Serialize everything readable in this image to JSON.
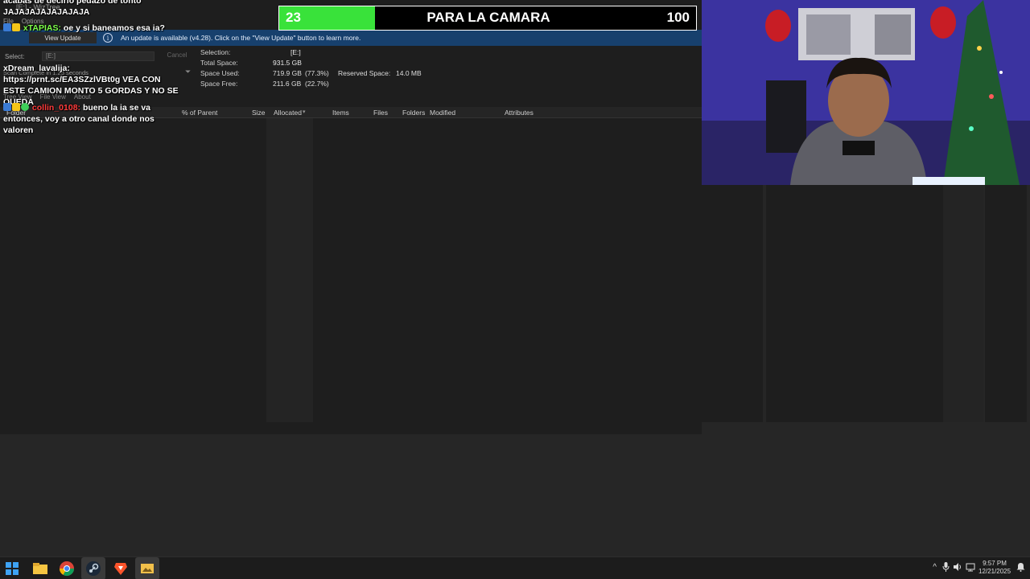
{
  "app": {
    "title": "[E:] - WizTree",
    "menu": [
      "File",
      "Options"
    ],
    "update_button": "View Update",
    "update_message": "An update is available (v4.28). Click on the \"View Update\" button to learn more.",
    "select_label": "Select:",
    "select_value": "[E:]",
    "cancel_label": "Cancel",
    "scan_status": "Scan Complete in 1.23 seconds",
    "stats": {
      "selection_label": "Selection:",
      "selection_value": "[E:]",
      "total_label": "Total Space:",
      "total_value": "931.5 GB",
      "used_label": "Space Used:",
      "used_value": "719.9 GB",
      "used_pct": "(77.3%)",
      "reserved_label": "Reserved Space:",
      "reserved_value": "14.0 MB",
      "free_label": "Space Free:",
      "free_value": "211.6 GB",
      "free_pct": "(22.7%)"
    },
    "tabs": [
      "Tree View",
      "File View",
      "About"
    ],
    "columns": {
      "folder": "Folder",
      "percent": "% of Parent",
      "size": "Size",
      "allocated": "Allocated",
      "items": "Items",
      "files": "Files",
      "folders": "Folders",
      "modified": "Modified",
      "attributes": "Attributes"
    }
  },
  "chat": [
    {
      "text": "acabas de decirlo pedazo de tonto JAJAJAJAJAJAJAJA"
    },
    {
      "user": "xTAPIAS:",
      "text": " oe y si baneamos esa ia?"
    },
    {
      "user": "xDream_lavalija:",
      "text": " https://prnt.sc/EA3SZzlVBt0g VEA CON ESTE CAMION MONTO 5 GORDAS Y NO SE QUEDA"
    },
    {
      "user": "collin_0108:",
      "text": " bueno la ia se va entonces, voy a otro canal donde nos valoren"
    }
  ],
  "goal": {
    "current": "23",
    "title": "PARA LA CAMARA",
    "target": "100",
    "progress": 0.23,
    "fill_color": "#39e23a"
  },
  "taskbar": {
    "apps": [
      "windows-start",
      "file-explorer",
      "chrome",
      "steam",
      "brave",
      "image-viewer"
    ],
    "time": "9:57 PM",
    "date": "12/21/2025"
  }
}
